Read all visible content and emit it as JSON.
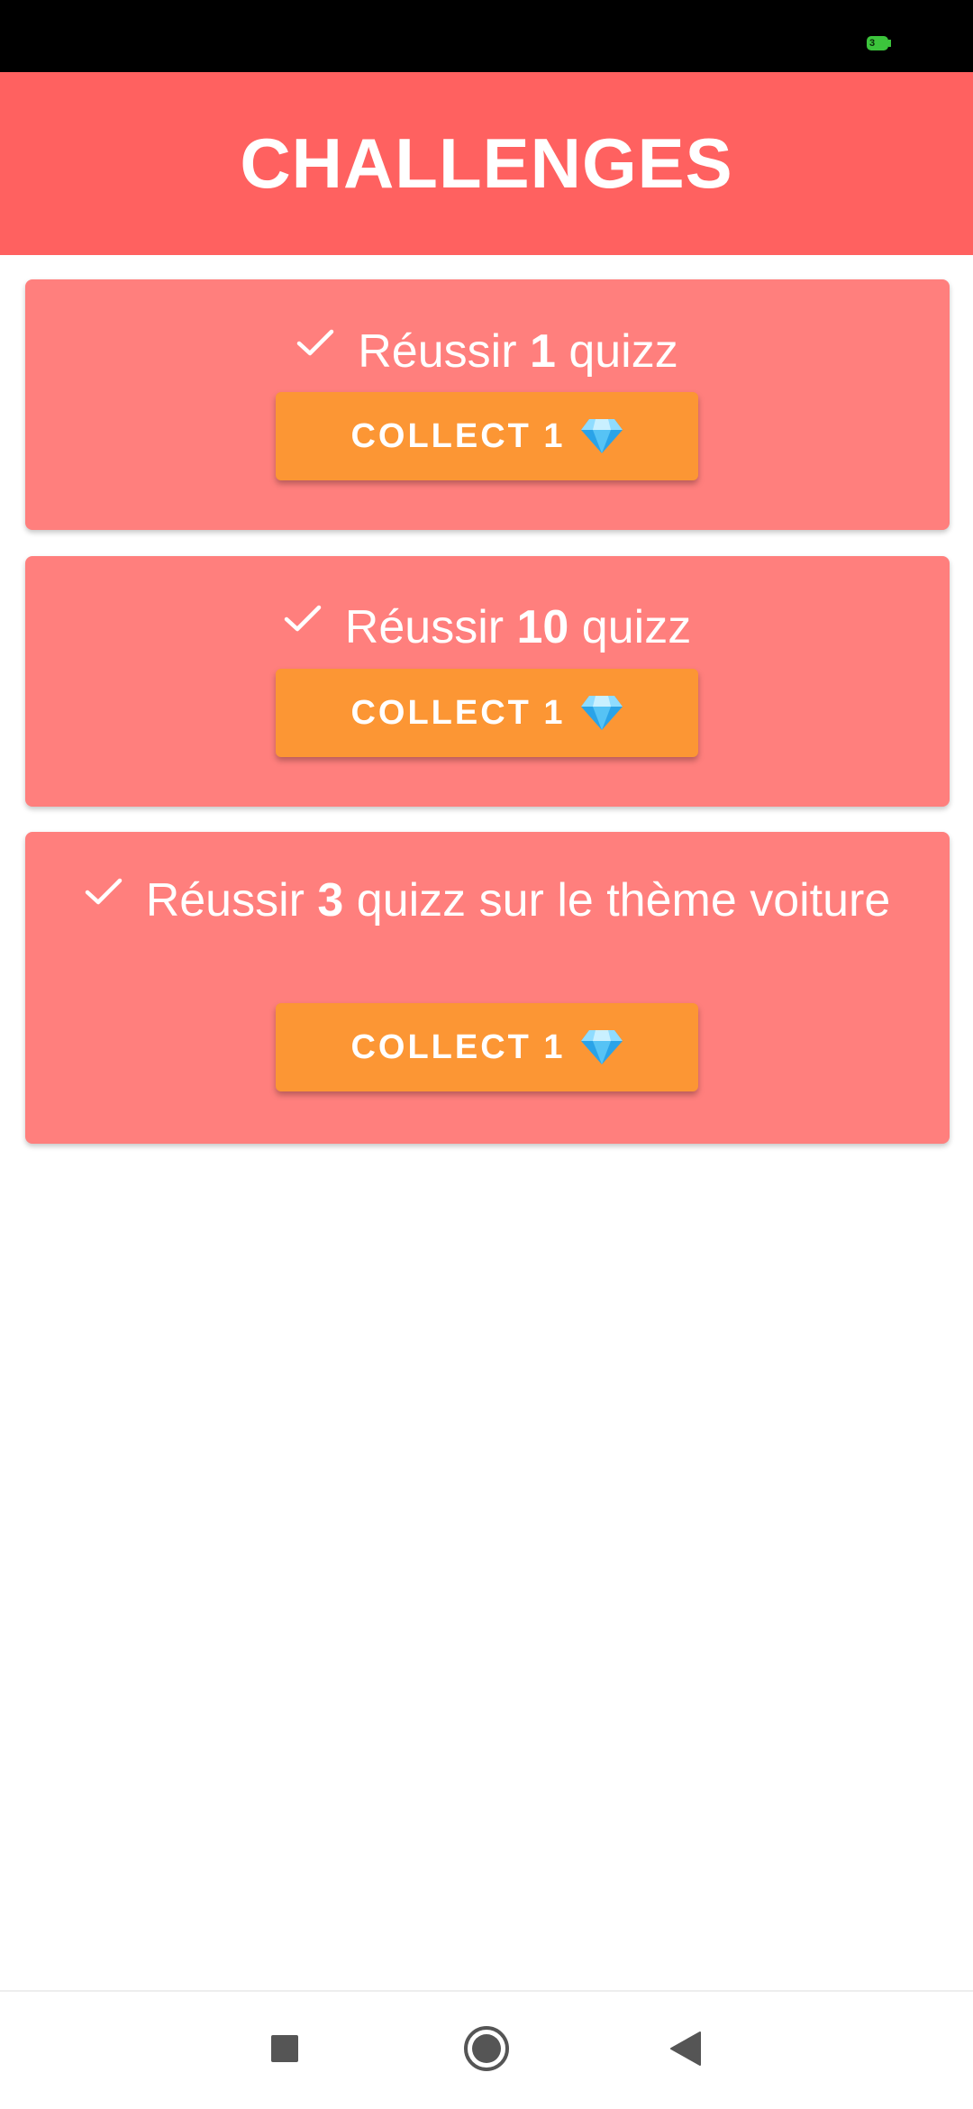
{
  "status_bar": {
    "battery_level": "3"
  },
  "header": {
    "title": "CHALLENGES"
  },
  "challenges": [
    {
      "prefix": "Réussir ",
      "count": "1",
      "suffix": " quizz",
      "button_label": "COLLECT 1"
    },
    {
      "prefix": "Réussir ",
      "count": "10",
      "suffix": " quizz",
      "button_label": "COLLECT 1"
    },
    {
      "prefix": "Réussir ",
      "count": "3",
      "suffix": " quizz sur le thème voiture",
      "button_label": "COLLECT 1"
    }
  ],
  "icons": {
    "check": "check-icon",
    "reward": "diamond-gem-icon",
    "nav_recents": "square-recents-icon",
    "nav_home": "circle-home-icon",
    "nav_back": "triangle-back-icon"
  },
  "colors": {
    "header_background": "#ff6160",
    "card_background": "#ff7f7d",
    "button_background": "#fc9634",
    "text": "#ffffff"
  }
}
